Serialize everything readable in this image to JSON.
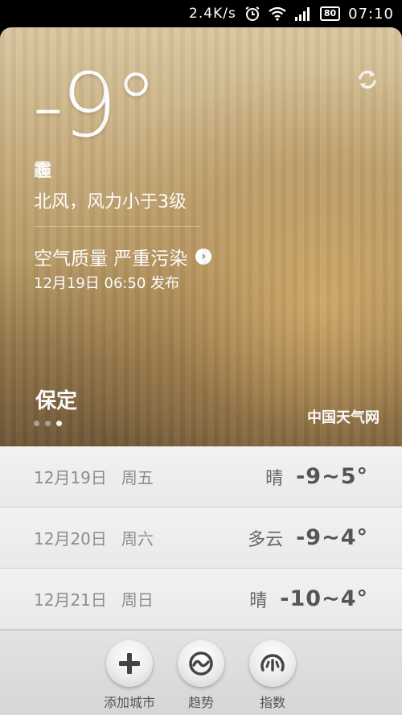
{
  "status_bar": {
    "net_speed": "2.4K/s",
    "battery": "80",
    "time": "07:10"
  },
  "current": {
    "temperature": "-9°",
    "condition": "霾",
    "wind": "北风，风力小于3级",
    "air_quality": "空气质量 严重污染",
    "publish_time": "12月19日 06:50 发布",
    "city": "保定",
    "page_count": 3,
    "active_page": 3,
    "source": "中国天气网"
  },
  "forecast": [
    {
      "date": "12月19日",
      "weekday": "周五",
      "condition": "晴",
      "range": "-9~5°"
    },
    {
      "date": "12月20日",
      "weekday": "周六",
      "condition": "多云",
      "range": "-9~4°"
    },
    {
      "date": "12月21日",
      "weekday": "周日",
      "condition": "晴",
      "range": "-10~4°"
    }
  ],
  "toolbar": {
    "add_city": "添加城市",
    "trend": "趋势",
    "index": "指数"
  }
}
